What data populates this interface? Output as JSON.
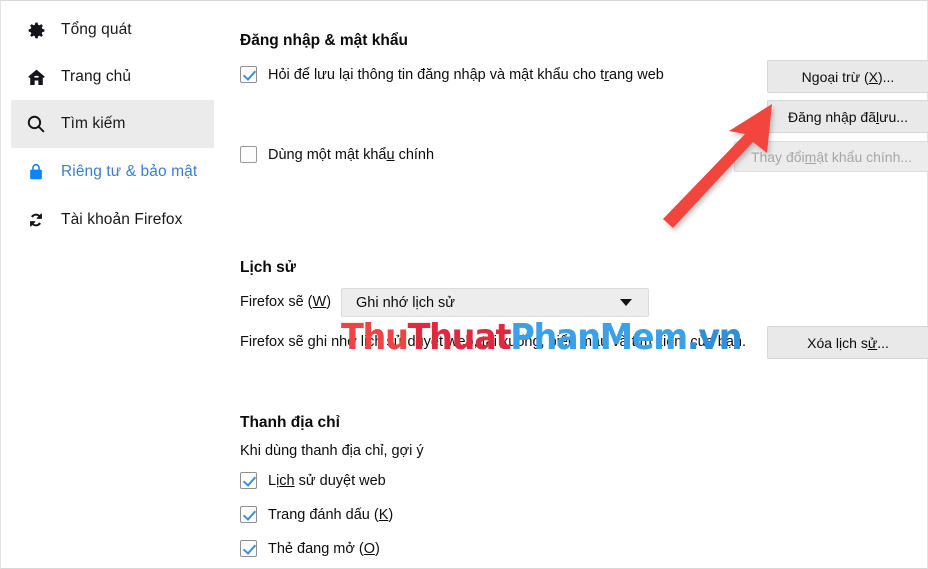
{
  "sidebar": {
    "items": [
      {
        "label": "Tổng quát",
        "icon": "gear-icon",
        "id": "general",
        "selected": false,
        "accent": false
      },
      {
        "label": "Trang chủ",
        "icon": "home-icon",
        "id": "home",
        "selected": false,
        "accent": false
      },
      {
        "label": "Tìm kiếm",
        "icon": "search-icon",
        "id": "search",
        "selected": true,
        "accent": false
      },
      {
        "label": "Riêng tư & bảo mật",
        "icon": "lock-icon",
        "id": "privacy",
        "selected": false,
        "accent": true
      },
      {
        "label": "Tài khoản Firefox",
        "icon": "sync-icon",
        "id": "account",
        "selected": false,
        "accent": false
      }
    ],
    "accent_color": "#3b7ecb",
    "selected_bg": "#ebebeb"
  },
  "logins_section": {
    "title": "Đăng nhập & mật khẩu",
    "ask_to_save": {
      "label_pre": "Hỏi để lưu lại thông tin đăng nhập và mật khẩu cho t",
      "label_key": "r",
      "label_post": "ang web",
      "checked": true
    },
    "master_password": {
      "label_pre": "Dùng một mật khẩ",
      "label_key": "u",
      "label_post": " chính",
      "checked": false
    },
    "exceptions_button": {
      "pre": "Ngoại trừ (",
      "key": "X",
      "post": ")...",
      "enabled": true
    },
    "saved_logins_button": {
      "pre": "Đăng nhập đã ",
      "key": "l",
      "post": "ưu...",
      "enabled": true
    },
    "change_master_password_button": {
      "pre": "Thay đổi ",
      "key": "m",
      "post": "ật khẩu chính...",
      "enabled": false
    }
  },
  "history_section": {
    "title": "Lịch sử",
    "will_label_pre": "Firefox sẽ (",
    "will_label_key": "W",
    "will_label_post": ")",
    "dropdown_value": "Ghi nhớ lịch sử",
    "description": "Firefox sẽ ghi nhớ lịch sử duyệt web, tải xuống, biểu mẫu và tìm kiếm của bạn.",
    "description_visible_start": "Firefox sẽ ghi n",
    "description_visible_end": "ẫu và tìm kiếm của bạn.",
    "clear_history_button": {
      "pre": "Xóa lịch s",
      "key": "ử",
      "post": "..."
    }
  },
  "address_bar_section": {
    "title": "Thanh địa chỉ",
    "subtitle": "Khi dùng thanh địa chỉ, gợi ý",
    "options": [
      {
        "pre": "Lị",
        "key": "ch",
        "post": " sử duyệt web",
        "checked": true
      },
      {
        "pre": "Trang đánh dấu (",
        "key": "K",
        "post": ")",
        "checked": true
      },
      {
        "pre": "Thẻ đang mở (",
        "key": "O",
        "post": ")",
        "checked": true
      }
    ]
  },
  "annotations": {
    "arrow": {
      "color": "#f2453d",
      "points_to": "saved-logins-button"
    },
    "watermark": {
      "part1": "Thu",
      "part2": "Thuat",
      "part3": "PhanMem",
      "part4": ".vn",
      "color1": "#ef4444",
      "color2": "#e0293f",
      "color3": "#3aa0e8",
      "color4": "#2f8fd8"
    }
  }
}
